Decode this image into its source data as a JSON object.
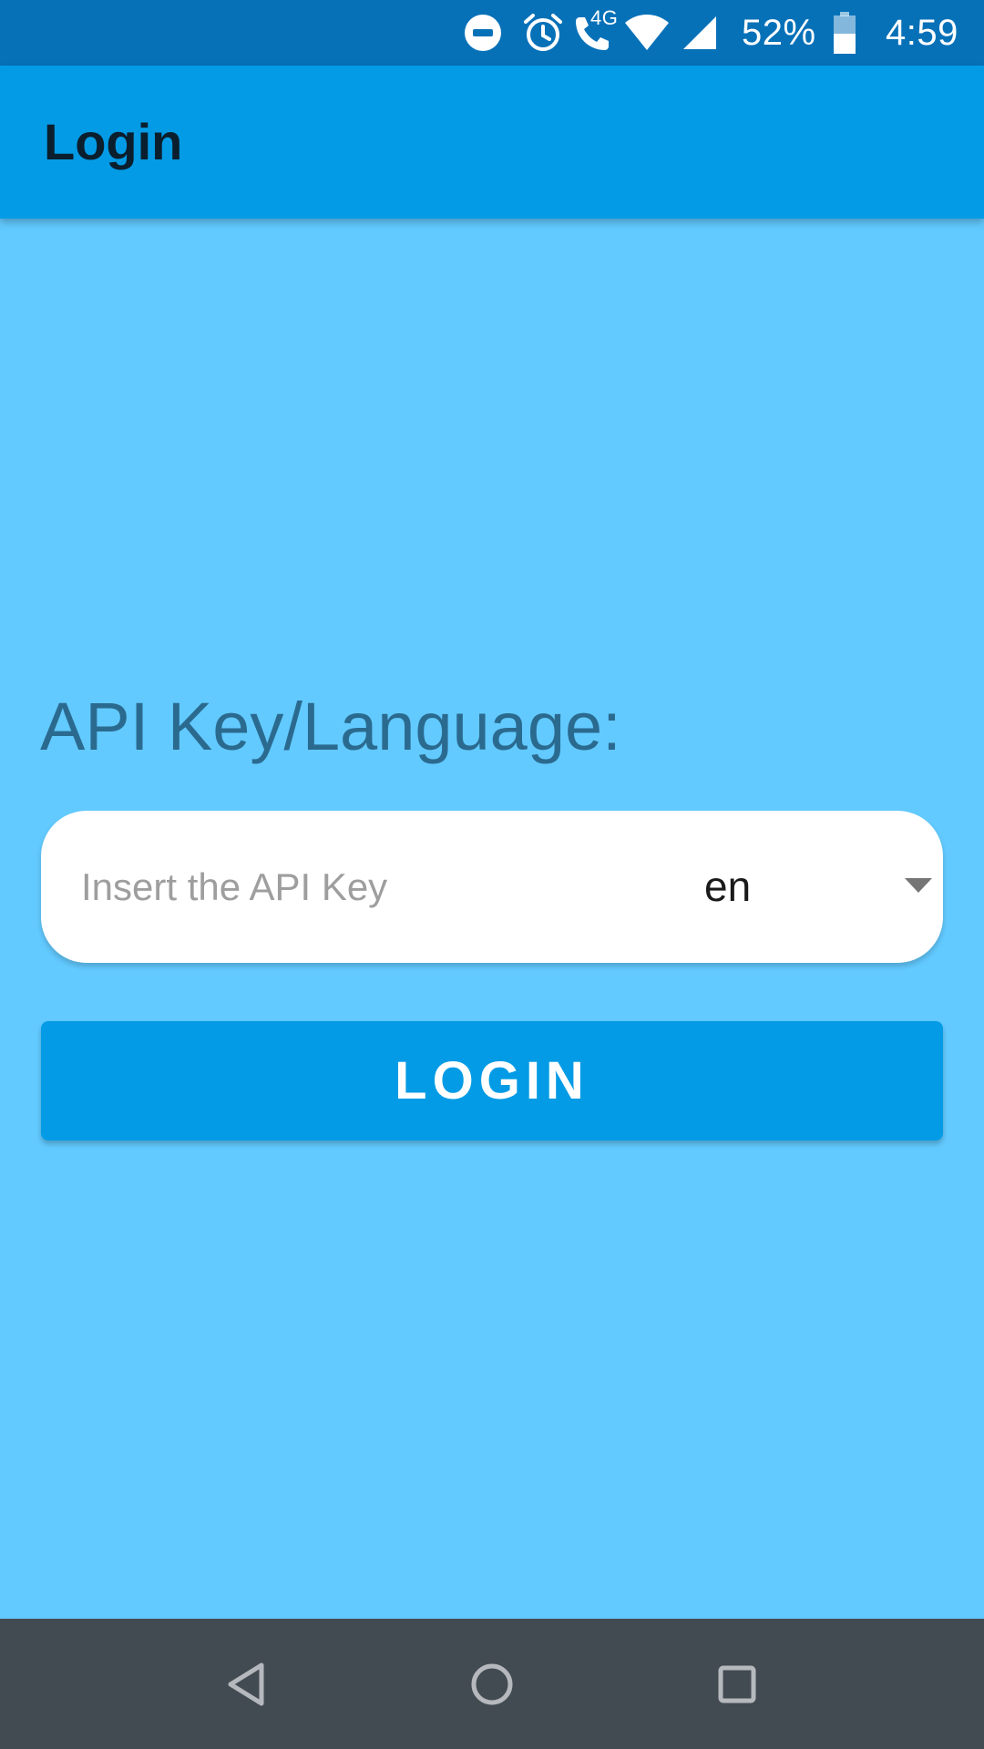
{
  "status_bar": {
    "dnd_icon": "do-not-disturb-icon",
    "alarm_icon": "alarm-icon",
    "call_icon": "volte-call-icon",
    "network_type": "4G",
    "wifi_icon": "wifi-icon",
    "signal_icon": "cell-signal-icon",
    "battery_percent": "52%",
    "battery_icon": "battery-icon",
    "time": "4:59"
  },
  "app_bar": {
    "title": "Login"
  },
  "form": {
    "section_label": "API Key/Language:",
    "api_key_placeholder": "Insert the API Key",
    "api_key_value": "",
    "language_selected": "en",
    "login_label": "LOGIN"
  },
  "nav_bar": {
    "back_icon": "back-icon",
    "home_icon": "home-icon",
    "recents_icon": "recents-icon"
  },
  "colors": {
    "status_bar": "#0771b8",
    "app_bar": "#039be5",
    "background": "#62caff",
    "button": "#039be5",
    "nav_bar": "#434b52"
  }
}
